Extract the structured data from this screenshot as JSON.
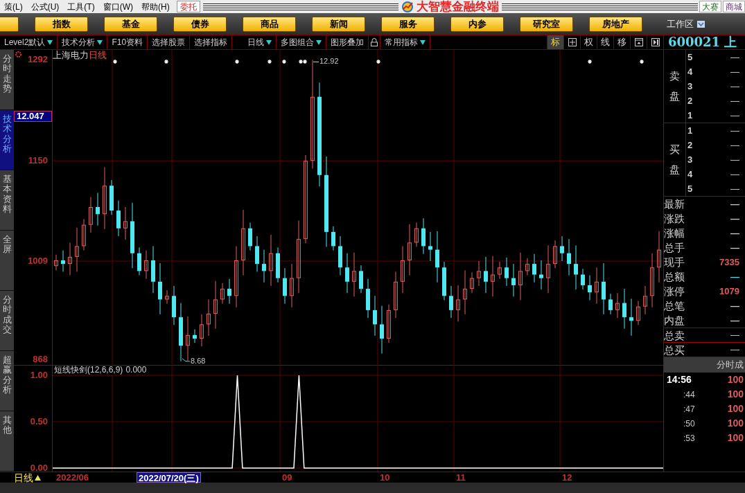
{
  "menu_bar": {
    "items": [
      "策(L)",
      "公式(U)",
      "工具(T)",
      "窗口(W)",
      "帮助(H)"
    ],
    "trade_button": "委托",
    "app_title": "大智慧金融终端",
    "right_buttons": [
      "大赛",
      "商城"
    ]
  },
  "nav_buttons": [
    "指数",
    "基金",
    "债券",
    "商品",
    "新闻",
    "服务",
    "内参",
    "研究室",
    "房地产"
  ],
  "workspace": {
    "label": "工作区"
  },
  "toolbar": {
    "items": [
      {
        "kind": "menu",
        "label": "Level2默认",
        "dropdown": true
      },
      {
        "kind": "menu",
        "label": "技术分析",
        "dropdown": true
      },
      {
        "kind": "menu",
        "label": "F10资料",
        "dropdown": false
      },
      {
        "kind": "menu",
        "label": "选择股票",
        "dropdown": false
      },
      {
        "kind": "menu",
        "label": "选择指标",
        "dropdown": false
      },
      {
        "kind": "menu",
        "label": "日线",
        "dropdown": true
      },
      {
        "kind": "menu",
        "label": "多图组合",
        "dropdown": true
      },
      {
        "kind": "menu",
        "label": "图形叠加",
        "dropdown": false
      },
      {
        "kind": "lock"
      },
      {
        "kind": "menu",
        "label": "常用指标",
        "dropdown": true
      }
    ],
    "tools": [
      {
        "kind": "text",
        "label": "标",
        "selected": true
      },
      {
        "kind": "grid",
        "selected": false
      },
      {
        "kind": "text",
        "label": "权",
        "selected": false
      },
      {
        "kind": "text",
        "label": "线",
        "selected": false
      },
      {
        "kind": "text",
        "label": "移",
        "selected": false
      },
      {
        "kind": "panel",
        "selected": false
      },
      {
        "kind": "end",
        "selected": false
      }
    ],
    "stock_code": "600021 上"
  },
  "side_tabs": [
    {
      "label": "分时走势",
      "selected": false
    },
    {
      "label": "技术分析",
      "selected": true
    },
    {
      "label": "基本资料",
      "selected": false
    },
    {
      "label": "全屏",
      "selected": false
    },
    {
      "label": "分时成交",
      "selected": false
    },
    {
      "label": "超赢分析",
      "selected": false
    },
    {
      "label": "其他",
      "selected": false
    }
  ],
  "price_chart": {
    "period": "日线",
    "cursor_price": "12.047",
    "high_label": "12.92",
    "low_label": "8.68",
    "chart_data": {
      "type": "candlestick",
      "title": "上海电力",
      "ylim": [
        862,
        1306
      ],
      "grid": true,
      "yticks": [
        {
          "value": 1292,
          "label": "1292"
        },
        {
          "value": 1150,
          "label": "1150"
        },
        {
          "value": 1009,
          "label": "1009"
        },
        {
          "value": 868,
          "label": "868"
        }
      ],
      "ohlc": [
        [
          1002,
          1018,
          996,
          1010
        ],
        [
          1010,
          1024,
          994,
          1005
        ],
        [
          1005,
          1035,
          989,
          1015
        ],
        [
          1015,
          1056,
          994,
          1030
        ],
        [
          1030,
          1068,
          1024,
          1060
        ],
        [
          1060,
          1099,
          1049,
          1085
        ],
        [
          1085,
          1105,
          1059,
          1075
        ],
        [
          1075,
          1141,
          1054,
          1115
        ],
        [
          1115,
          1123,
          1074,
          1080
        ],
        [
          1080,
          1094,
          1044,
          1055
        ],
        [
          1055,
          1085,
          1039,
          1065
        ],
        [
          1065,
          1091,
          999,
          1020
        ],
        [
          1020,
          1028,
          989,
          995
        ],
        [
          995,
          1024,
          984,
          1010
        ],
        [
          1010,
          1030,
          964,
          980
        ],
        [
          980,
          1006,
          934,
          955
        ],
        [
          955,
          968,
          949,
          960
        ],
        [
          960,
          974,
          919,
          930
        ],
        [
          930,
          950,
          868,
          890
        ],
        [
          890,
          931,
          869,
          905
        ],
        [
          905,
          913,
          894,
          900
        ],
        [
          900,
          934,
          889,
          920
        ],
        [
          920,
          955,
          904,
          935
        ],
        [
          935,
          981,
          914,
          955
        ],
        [
          955,
          978,
          949,
          970
        ],
        [
          970,
          984,
          949,
          960
        ],
        [
          960,
          1030,
          944,
          1010
        ],
        [
          1010,
          1081,
          989,
          1055
        ],
        [
          1055,
          1063,
          1024,
          1030
        ],
        [
          1030,
          1044,
          994,
          1005
        ],
        [
          1005,
          1025,
          979,
          995
        ],
        [
          995,
          1046,
          974,
          1020
        ],
        [
          1020,
          1028,
          979,
          985
        ],
        [
          985,
          999,
          949,
          960
        ],
        [
          960,
          1005,
          944,
          985
        ],
        [
          985,
          1066,
          964,
          1040
        ],
        [
          1040,
          1158,
          1034,
          1150
        ],
        [
          1150,
          1292,
          1139,
          1240
        ],
        [
          1240,
          1260,
          1114,
          1130
        ],
        [
          1130,
          1156,
          1029,
          1050
        ],
        [
          1050,
          1058,
          1024,
          1030
        ],
        [
          1030,
          1044,
          989,
          1000
        ],
        [
          1000,
          1020,
          964,
          980
        ],
        [
          980,
          1021,
          959,
          995
        ],
        [
          995,
          1003,
          964,
          970
        ],
        [
          970,
          984,
          929,
          940
        ],
        [
          940,
          960,
          904,
          920
        ],
        [
          920,
          946,
          879,
          900
        ],
        [
          900,
          948,
          894,
          940
        ],
        [
          940,
          994,
          929,
          980
        ],
        [
          980,
          1030,
          964,
          1010
        ],
        [
          1010,
          1061,
          989,
          1035
        ],
        [
          1035,
          1063,
          1029,
          1055
        ],
        [
          1055,
          1069,
          1019,
          1030
        ],
        [
          1030,
          1050,
          1009,
          1025
        ],
        [
          1025,
          1051,
          979,
          1000
        ],
        [
          1000,
          1008,
          954,
          960
        ],
        [
          960,
          974,
          929,
          940
        ],
        [
          940,
          975,
          924,
          955
        ],
        [
          955,
          996,
          934,
          970
        ],
        [
          970,
          993,
          964,
          985
        ],
        [
          985,
          1009,
          974,
          995
        ],
        [
          995,
          1015,
          964,
          980
        ],
        [
          980,
          1016,
          959,
          990
        ],
        [
          990,
          1008,
          984,
          1000
        ],
        [
          1000,
          1014,
          974,
          985
        ],
        [
          985,
          1005,
          959,
          975
        ],
        [
          975,
          1021,
          954,
          995
        ],
        [
          995,
          1013,
          989,
          1005
        ],
        [
          1005,
          1019,
          979,
          990
        ],
        [
          990,
          1010,
          969,
          985
        ],
        [
          985,
          1031,
          964,
          1005
        ],
        [
          1005,
          1038,
          999,
          1030
        ],
        [
          1030,
          1044,
          1009,
          1020
        ],
        [
          1020,
          1040,
          989,
          1005
        ],
        [
          1005,
          1031,
          969,
          990
        ],
        [
          990,
          998,
          969,
          975
        ],
        [
          975,
          989,
          954,
          965
        ],
        [
          965,
          1000,
          949,
          980
        ],
        [
          980,
          1006,
          934,
          955
        ],
        [
          955,
          963,
          934,
          940
        ],
        [
          940,
          964,
          929,
          950
        ],
        [
          950,
          970,
          914,
          930
        ],
        [
          930,
          956,
          904,
          925
        ],
        [
          925,
          953,
          919,
          945
        ],
        [
          945,
          974,
          934,
          960
        ],
        [
          960,
          1020,
          944,
          1000
        ],
        [
          1000,
          1051,
          979,
          1025
        ]
      ]
    }
  },
  "indicator": {
    "params": "(12,6,6,9)",
    "reading": "0.000",
    "chart_data": {
      "type": "line",
      "ylim": [
        0,
        1
      ],
      "yticks": [
        {
          "value": 1,
          "label": "1.00"
        },
        {
          "value": 0.5,
          "label": "0.50"
        },
        {
          "value": 0,
          "label": "0.00"
        }
      ],
      "series": [
        {
          "name": "短线快剑",
          "color": "#ffffff",
          "values": [
            0,
            0,
            0,
            0,
            0,
            0,
            0,
            0,
            0,
            0,
            0,
            0,
            0,
            0,
            0,
            0,
            0,
            0,
            0,
            0,
            0,
            0,
            0,
            0,
            0,
            0,
            0,
            0,
            0,
            0,
            0,
            0,
            0,
            0,
            0,
            0,
            1,
            0,
            0,
            0,
            0,
            0,
            0,
            0,
            0,
            0,
            0,
            0,
            1,
            0,
            0,
            0,
            0,
            0,
            0,
            0,
            0,
            0,
            0,
            0,
            0,
            0,
            0,
            0,
            0,
            0,
            0,
            0,
            0,
            0,
            0,
            0,
            0,
            0,
            0,
            0,
            0,
            0,
            0,
            0,
            0,
            0,
            0,
            0,
            0,
            0,
            0,
            0,
            0,
            0,
            0,
            0,
            0,
            0,
            0,
            0,
            0,
            0,
            0,
            0,
            0,
            0,
            0,
            0,
            0,
            0,
            0,
            0,
            0,
            0,
            0,
            0,
            0,
            0,
            0,
            0,
            0,
            0,
            0,
            0
          ]
        }
      ]
    }
  },
  "date_axis": {
    "period": "日线",
    "labels": [
      {
        "text": "2022/06",
        "selected": false
      },
      {
        "text": "2022/07/20(三)",
        "selected": true
      },
      {
        "text": "09",
        "selected": false
      },
      {
        "text": "10",
        "selected": false
      },
      {
        "text": "11",
        "selected": false
      },
      {
        "text": "12",
        "selected": false
      }
    ]
  },
  "quote_panel": {
    "sell": {
      "label": "卖盘",
      "rows": [
        {
          "num": "5",
          "value": "—"
        },
        {
          "num": "4",
          "value": "—"
        },
        {
          "num": "3",
          "value": "—"
        },
        {
          "num": "2",
          "value": "—"
        },
        {
          "num": "1",
          "value": "—"
        }
      ]
    },
    "buy": {
      "label": "买盘",
      "rows": [
        {
          "num": "1",
          "value": "—"
        },
        {
          "num": "2",
          "value": "—"
        },
        {
          "num": "3",
          "value": "—"
        },
        {
          "num": "4",
          "value": "—"
        },
        {
          "num": "5",
          "value": "—"
        }
      ]
    },
    "stats": [
      {
        "label": "最新",
        "value": "—",
        "color": "#c8c8c8"
      },
      {
        "label": "涨跌",
        "value": "—",
        "color": "#c8c8c8"
      },
      {
        "label": "涨幅",
        "value": "—",
        "color": "#c8c8c8"
      },
      {
        "label": "总手",
        "value": "—",
        "color": "#c8c8c8"
      },
      {
        "label": "现手",
        "value": "7335",
        "color": "#e05a5a"
      },
      {
        "label": "总额",
        "value": "—",
        "color": "#5ad8e8"
      },
      {
        "label": "涨停",
        "value": "1079",
        "color": "#e05a5a"
      },
      {
        "label": "总笔",
        "value": "—",
        "color": "#c8c8c8"
      },
      {
        "label": "内盘",
        "value": "—",
        "color": "#c8c8c8"
      }
    ],
    "totals": [
      {
        "label": "总卖",
        "value": "—"
      },
      {
        "label": "总买",
        "value": "—"
      }
    ],
    "ticks": {
      "header": "分时成",
      "rows": [
        {
          "time": "14:56",
          "price": "100",
          "bold": true
        },
        {
          "time": ":44",
          "price": "100",
          "bold": false
        },
        {
          "time": ":47",
          "price": "100",
          "bold": false
        },
        {
          "time": ":50",
          "price": "100",
          "bold": false
        },
        {
          "time": ":53",
          "price": "100",
          "bold": false
        }
      ]
    }
  }
}
